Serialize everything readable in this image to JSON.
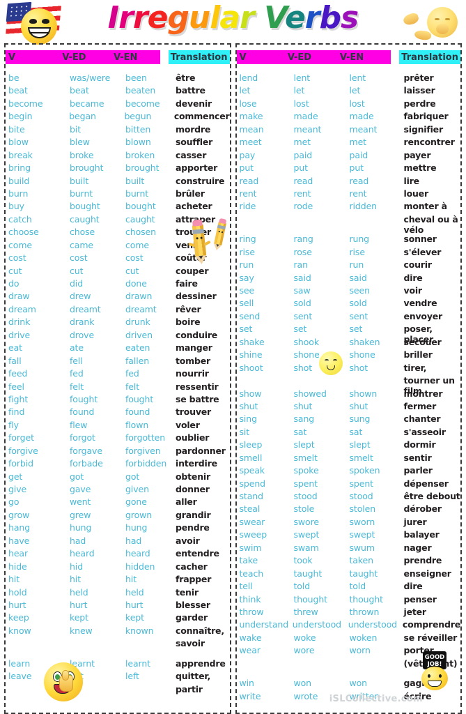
{
  "title": {
    "letters": [
      {
        "ch": "I",
        "color": "#d6008c"
      },
      {
        "ch": "r",
        "color": "#e3007a"
      },
      {
        "ch": "r",
        "color": "#ef0f3f"
      },
      {
        "ch": "e",
        "color": "#f4231f"
      },
      {
        "ch": "g",
        "color": "#f7651a"
      },
      {
        "ch": "u",
        "color": "#fb9a0e"
      },
      {
        "ch": "l",
        "color": "#fdc70c"
      },
      {
        "ch": "a",
        "color": "#f5e50a"
      },
      {
        "ch": "r",
        "color": "#c8e01a"
      },
      {
        "ch": " ",
        "color": "#ffffff"
      },
      {
        "ch": "V",
        "color": "#2f9e4f"
      },
      {
        "ch": "e",
        "color": "#16857f"
      },
      {
        "ch": "r",
        "color": "#1d52c7"
      },
      {
        "ch": "b",
        "color": "#4a17c4"
      },
      {
        "ch": "s",
        "color": "#9b10b8"
      }
    ],
    "text": "Irregular Verbs"
  },
  "columns": {
    "v": "V",
    "ved": "V-ED",
    "ven": "V-EN",
    "translation": "Translation"
  },
  "colors": {
    "verb_blue": "#4ab9d6",
    "translation_dark": "#231f20",
    "header_magenta": "#ff00e4",
    "header_cyan": "#2ff0f7"
  },
  "footer": {
    "watermark": "iSLCollective.com",
    "badge_line1": "GOOD",
    "badge_line2": "JOB!"
  },
  "left_rows": [
    {
      "v": "be",
      "ved": "was/were",
      "ven": "been",
      "tr": "être"
    },
    {
      "v": "beat",
      "ved": "beat",
      "ven": "beaten",
      "tr": "battre"
    },
    {
      "v": "become",
      "ved": "became",
      "ven": "become",
      "tr": "devenir"
    },
    {
      "v": "begin",
      "ved": "began",
      "ven": "begun",
      "tr": "commencer"
    },
    {
      "v": "bite",
      "ved": "bit",
      "ven": "bitten",
      "tr": "mordre"
    },
    {
      "v": "blow",
      "ved": "blew",
      "ven": "blown",
      "tr": "souffler"
    },
    {
      "v": "break",
      "ved": "broke",
      "ven": "broken",
      "tr": "casser"
    },
    {
      "v": "bring",
      "ved": "brought",
      "ven": "brought",
      "tr": "apporter"
    },
    {
      "v": "build",
      "ved": "built",
      "ven": "built",
      "tr": "construire"
    },
    {
      "v": "burn",
      "ved": "burnt",
      "ven": "burnt",
      "tr": "brûler"
    },
    {
      "v": "buy",
      "ved": "bought",
      "ven": "bought",
      "tr": "acheter"
    },
    {
      "v": "catch",
      "ved": "caught",
      "ven": "caught",
      "tr": "attraper"
    },
    {
      "v": "choose",
      "ved": "chose",
      "ven": "chosen",
      "tr": "trouver"
    },
    {
      "v": "come",
      "ved": "came",
      "ven": "come",
      "tr": "venir"
    },
    {
      "v": "cost",
      "ved": "cost",
      "ven": "cost",
      "tr": "coûter"
    },
    {
      "v": "cut",
      "ved": "cut",
      "ven": "cut",
      "tr": "couper"
    },
    {
      "v": "do",
      "ved": "did",
      "ven": "done",
      "tr": "faire"
    },
    {
      "v": "draw",
      "ved": "drew",
      "ven": "drawn",
      "tr": "dessiner"
    },
    {
      "v": "dream",
      "ved": "dreamt",
      "ven": "dreamt",
      "tr": "rêver"
    },
    {
      "v": "drink",
      "ved": "drank",
      "ven": "drunk",
      "tr": "boire"
    },
    {
      "v": "drive",
      "ved": "drove",
      "ven": "driven",
      "tr": "conduire"
    },
    {
      "v": "eat",
      "ved": "ate",
      "ven": "eaten",
      "tr": "manger"
    },
    {
      "v": "fall",
      "ved": "fell",
      "ven": "fallen",
      "tr": "tomber"
    },
    {
      "v": "feed",
      "ved": "fed",
      "ven": "fed",
      "tr": "nourrir"
    },
    {
      "v": "feel",
      "ved": "felt",
      "ven": "felt",
      "tr": "ressentir"
    },
    {
      "v": "fight",
      "ved": "fought",
      "ven": "fought",
      "tr": "se battre"
    },
    {
      "v": "find",
      "ved": "found",
      "ven": "found",
      "tr": "trouver"
    },
    {
      "v": "fly",
      "ved": "flew",
      "ven": "flown",
      "tr": "voler"
    },
    {
      "v": "forget",
      "ved": "forgot",
      "ven": "forgotten",
      "tr": "oublier"
    },
    {
      "v": "forgive",
      "ved": "forgave",
      "ven": "forgiven",
      "tr": "pardonner"
    },
    {
      "v": "forbid",
      "ved": "forbade",
      "ven": "forbidden",
      "tr": "interdire"
    },
    {
      "v": " get",
      "ved": "got",
      "ven": "got",
      "tr": "obtenir"
    },
    {
      "v": "give",
      "ved": "gave",
      "ven": "given",
      "tr": "donner"
    },
    {
      "v": "go",
      "ved": "went",
      "ven": "gone",
      "tr": "aller"
    },
    {
      "v": "grow",
      "ved": "grew",
      "ven": "grown",
      "tr": "grandir"
    },
    {
      "v": "hang",
      "ved": "hung",
      "ven": "hung",
      "tr": "pendre"
    },
    {
      "v": "have",
      "ved": "had",
      "ven": "had",
      "tr": "avoir"
    },
    {
      "v": "hear",
      "ved": "heard",
      "ven": "heard",
      "tr": "entendre"
    },
    {
      "v": "hide",
      "ved": "hid",
      "ven": "hidden",
      "tr": "cacher"
    },
    {
      "v": "hit",
      "ved": "hit",
      "ven": "hit",
      "tr": "frapper"
    },
    {
      "v": "hold",
      "ved": "held",
      "ven": "held",
      "tr": "tenir"
    },
    {
      "v": "hurt",
      "ved": "hurt",
      "ven": "hurt",
      "tr": "blesser"
    },
    {
      "v": "keep",
      "ved": "kept",
      "ven": "kept",
      "tr": "garder"
    },
    {
      "v": "know",
      "ved": "knew",
      "ven": "known",
      "tr": "connaître,"
    },
    {
      "v": "",
      "ved": "",
      "ven": "",
      "tr": "savoir"
    },
    {
      "v": "",
      "ved": "",
      "ven": "",
      "tr": "",
      "spacer": true
    },
    {
      "v": "learn",
      "ved": "learnt",
      "ven": "learnt",
      "tr": "apprendre"
    },
    {
      "v": "leave",
      "ved": "left",
      "ven": "left",
      "tr": "quitter,"
    },
    {
      "v": "",
      "ved": "",
      "ven": "",
      "tr": "partir"
    }
  ],
  "right_rows": [
    {
      "v": "lend",
      "ved": "lent",
      "ven": "lent",
      "tr": "prêter"
    },
    {
      "v": "let",
      "ved": "let",
      "ven": "let",
      "tr": "laisser"
    },
    {
      "v": "lose",
      "ved": "lost",
      "ven": "lost",
      "tr": "perdre"
    },
    {
      "v": "make",
      "ved": "made",
      "ven": "made",
      "tr": "fabriquer"
    },
    {
      "v": "mean",
      "ved": "meant",
      "ven": "meant",
      "tr": "signifier"
    },
    {
      "v": "meet",
      "ved": "met",
      "ven": "met",
      "tr": "rencontrer"
    },
    {
      "v": "pay",
      "ved": "paid",
      "ven": "paid",
      "tr": "payer"
    },
    {
      "v": "put",
      "ved": "put",
      "ven": "put",
      "tr": "mettre"
    },
    {
      "v": "read",
      "ved": "read",
      "ven": "read",
      "tr": "lire"
    },
    {
      "v": "rent",
      "ved": "rent",
      "ven": "rent",
      "tr": "louer"
    },
    {
      "v": "ride",
      "ved": "rode",
      "ven": "ridden",
      "tr": "monter à"
    },
    {
      "v": "",
      "ved": "",
      "ven": "",
      "tr": "cheval ou à vélo"
    },
    {
      "v": "",
      "ved": "",
      "ven": "",
      "tr": "",
      "spacer": true
    },
    {
      "v": "ring",
      "ved": "rang",
      "ven": "rung",
      "tr": "sonner"
    },
    {
      "v": "rise",
      "ved": "rose",
      "ven": "rise",
      "tr": "s'élever"
    },
    {
      "v": "run",
      "ved": "ran",
      "ven": "run",
      "tr": "courir"
    },
    {
      "v": "say",
      "ved": "said",
      "ven": "said",
      "tr": "dire"
    },
    {
      "v": "see",
      "ved": "saw",
      "ven": "seen",
      "tr": "voir"
    },
    {
      "v": "sell",
      "ved": "sold",
      "ven": "sold",
      "tr": "vendre"
    },
    {
      "v": "send",
      "ved": "sent",
      "ven": "sent",
      "tr": "envoyer"
    },
    {
      "v": "set",
      "ved": "set",
      "ven": "set",
      "tr": "poser, placer"
    },
    {
      "v": "shake",
      "ved": "shook",
      "ven": "shaken",
      "tr": "secouer"
    },
    {
      "v": "shine",
      "ved": "shone",
      "ven": "shone",
      "tr": "briller"
    },
    {
      "v": "shoot",
      "ved": "shot",
      "ven": "shot",
      "tr": "tirer,"
    },
    {
      "v": "",
      "ved": "",
      "ven": "",
      "tr": "tourner un film"
    },
    {
      "v": "show",
      "ved": "showed",
      "ven": "shown",
      "tr": "montrer"
    },
    {
      "v": "shut",
      "ved": "shut",
      "ven": "shut",
      "tr": "fermer"
    },
    {
      "v": "sing",
      "ved": "sang",
      "ven": "sung",
      "tr": "chanter"
    },
    {
      "v": "sit",
      "ved": "sat",
      "ven": "sat",
      "tr": "s'asseoir"
    },
    {
      "v": "sleep",
      "ved": "slept",
      "ven": "slept",
      "tr": "dormir"
    },
    {
      "v": "smell",
      "ved": "smelt",
      "ven": "smelt",
      "tr": "sentir"
    },
    {
      "v": "speak",
      "ved": "spoke",
      "ven": "spoken",
      "tr": "parler"
    },
    {
      "v": "spend",
      "ved": "spent",
      "ven": "spent",
      "tr": "dépenser"
    },
    {
      "v": "stand",
      "ved": "stood",
      "ven": "stood",
      "tr": "être debout"
    },
    {
      "v": "steal",
      "ved": "stole",
      "ven": "stolen",
      "tr": "dérober"
    },
    {
      "v": "swear",
      "ved": "swore",
      "ven": "sworn",
      "tr": "jurer"
    },
    {
      "v": "sweep",
      "ved": "swept",
      "ven": "swept",
      "tr": "balayer"
    },
    {
      "v": "swim",
      "ved": "swam",
      "ven": "swum",
      "tr": "nager"
    },
    {
      "v": "take",
      "ved": "took",
      "ven": "taken",
      "tr": "prendre"
    },
    {
      "v": "teach",
      "ved": "taught",
      "ven": "taught",
      "tr": "enseigner"
    },
    {
      "v": "tell",
      "ved": "told",
      "ven": "told",
      "tr": "dire"
    },
    {
      "v": "think",
      "ved": "thought",
      "ven": "thought",
      "tr": "penser"
    },
    {
      "v": "throw",
      "ved": "threw",
      "ven": "thrown",
      "tr": "jeter"
    },
    {
      "v": "understand",
      "ved": "understood",
      "ven": "understood",
      "tr": "comprendre",
      "wide": true
    },
    {
      "v": "wake",
      "ved": "woke",
      "ven": "woken",
      "tr": "se réveiller"
    },
    {
      "v": "wear",
      "ved": "wore",
      "ven": "worn",
      "tr": "porter"
    },
    {
      "v": "",
      "ved": "",
      "ven": "",
      "tr": "(vêtement)"
    },
    {
      "v": "",
      "ved": "",
      "ven": "",
      "tr": "",
      "spacer": true
    },
    {
      "v": "win",
      "ved": "won",
      "ven": "won",
      "tr": "gagner"
    },
    {
      "v": "write",
      "ved": "wrote",
      "ven": "written",
      "tr": "écrire"
    }
  ]
}
